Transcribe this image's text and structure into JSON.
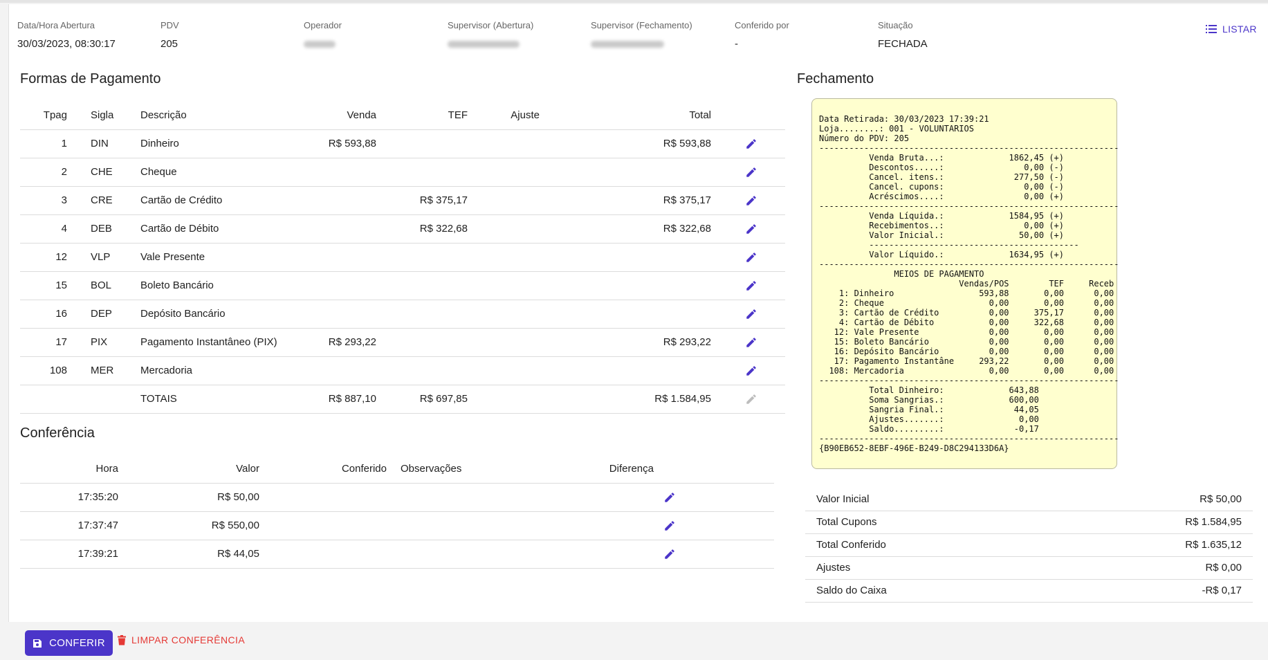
{
  "header": {
    "fields": [
      {
        "label": "Data/Hora Abertura",
        "value": "30/03/2023, 08:30:17"
      },
      {
        "label": "PDV",
        "value": "205"
      },
      {
        "label": "Operador",
        "value": ""
      },
      {
        "label": "Supervisor (Abertura)",
        "value": ""
      },
      {
        "label": "Supervisor (Fechamento)",
        "value": ""
      },
      {
        "label": "Conferido por",
        "value": "-"
      },
      {
        "label": "Situação",
        "value": "FECHADA"
      }
    ],
    "listar_label": "LISTAR"
  },
  "pagamento": {
    "title": "Formas de Pagamento",
    "columns": {
      "tpag": "Tpag",
      "sigla": "Sigla",
      "descricao": "Descrição",
      "venda": "Venda",
      "tef": "TEF",
      "ajuste": "Ajuste",
      "total": "Total"
    },
    "rows": [
      {
        "tpag": "1",
        "sigla": "DIN",
        "descricao": "Dinheiro",
        "venda": "R$ 593,88",
        "tef": "",
        "ajuste": "",
        "total": "R$ 593,88"
      },
      {
        "tpag": "2",
        "sigla": "CHE",
        "descricao": "Cheque",
        "venda": "",
        "tef": "",
        "ajuste": "",
        "total": ""
      },
      {
        "tpag": "3",
        "sigla": "CRE",
        "descricao": "Cartão de Crédito",
        "venda": "",
        "tef": "R$ 375,17",
        "ajuste": "",
        "total": "R$ 375,17"
      },
      {
        "tpag": "4",
        "sigla": "DEB",
        "descricao": "Cartão de Débito",
        "venda": "",
        "tef": "R$ 322,68",
        "ajuste": "",
        "total": "R$ 322,68"
      },
      {
        "tpag": "12",
        "sigla": "VLP",
        "descricao": "Vale Presente",
        "venda": "",
        "tef": "",
        "ajuste": "",
        "total": ""
      },
      {
        "tpag": "15",
        "sigla": "BOL",
        "descricao": "Boleto Bancário",
        "venda": "",
        "tef": "",
        "ajuste": "",
        "total": ""
      },
      {
        "tpag": "16",
        "sigla": "DEP",
        "descricao": "Depósito Bancário",
        "venda": "",
        "tef": "",
        "ajuste": "",
        "total": ""
      },
      {
        "tpag": "17",
        "sigla": "PIX",
        "descricao": "Pagamento Instantâneo (PIX)",
        "venda": "R$ 293,22",
        "tef": "",
        "ajuste": "",
        "total": "R$ 293,22"
      },
      {
        "tpag": "108",
        "sigla": "MER",
        "descricao": "Mercadoria",
        "venda": "",
        "tef": "",
        "ajuste": "",
        "total": ""
      }
    ],
    "totals": {
      "label": "TOTAIS",
      "venda": "R$ 887,10",
      "tef": "R$ 697,85",
      "ajuste": "",
      "total": "R$ 1.584,95"
    }
  },
  "conferencia": {
    "title": "Conferência",
    "columns": {
      "hora": "Hora",
      "valor": "Valor",
      "conferido": "Conferido",
      "observacoes": "Observações",
      "diferenca": "Diferença"
    },
    "rows": [
      {
        "hora": "17:35:20",
        "valor": "R$ 50,00",
        "conferido": "",
        "observacoes": "",
        "diferenca": ""
      },
      {
        "hora": "17:37:47",
        "valor": "R$ 550,00",
        "conferido": "",
        "observacoes": "",
        "diferenca": ""
      },
      {
        "hora": "17:39:21",
        "valor": "R$ 44,05",
        "conferido": "",
        "observacoes": "",
        "diferenca": ""
      }
    ]
  },
  "fechamento": {
    "title": "Fechamento",
    "receipt_text": "Data Retirada: 30/03/2023 17:39:21\nLoja........: 001 - VOLUNTARIOS\nNúmero do PDV: 205\n------------------------------------------------------------\n          Venda Bruta...:             1862,45 (+)\n          Descontos.....:                0,00 (-)\n          Cancel. itens.:              277,50 (-)\n          Cancel. cupons:                0,00 (-)\n          Acréscimos....:                0,00 (+)\n------------------------------------------------------------\n          Venda Líquida.:             1584,95 (+)\n          Recebimentos..:                0,00 (+)\n          Valor Inicial.:               50,00 (+)\n          ------------------------------------------\n          Valor Líquido.:             1634,95 (+)\n------------------------------------------------------------\n               MEIOS DE PAGAMENTO\n                            Vendas/POS        TEF     Receb\n    1: Dinheiro                 593,88       0,00      0,00\n    2: Cheque                     0,00       0,00      0,00\n    3: Cartão de Crédito          0,00     375,17      0,00\n    4: Cartão de Débito           0,00     322,68      0,00\n   12: Vale Presente              0,00       0,00      0,00\n   15: Boleto Bancário            0,00       0,00      0,00\n   16: Depósito Bancário          0,00       0,00      0,00\n   17: Pagamento Instantâne     293,22       0,00      0,00\n  108: Mercadoria                 0,00       0,00      0,00\n------------------------------------------------------------\n          Total Dinheiro:             643,88\n          Soma Sangrias.:             600,00\n          Sangria Final.:              44,05\n          Ajustes.......:               0,00\n          Saldo.........:              -0,17\n------------------------------------------------------------\n{B90EB652-8EBF-496E-B249-D8C294133D6A}"
  },
  "summary": [
    {
      "label": "Valor Inicial",
      "value": "R$ 50,00"
    },
    {
      "label": "Total Cupons",
      "value": "R$ 1.584,95"
    },
    {
      "label": "Total Conferido",
      "value": "R$ 1.635,12"
    },
    {
      "label": "Ajustes",
      "value": "R$ 0,00"
    },
    {
      "label": "Saldo do Caixa",
      "value": "-R$ 0,17"
    }
  ],
  "actions": {
    "conferir_label": "CONFERIR",
    "limpar_label": "LIMPAR CONFERÊNCIA"
  },
  "colors": {
    "accent": "#4b35c9",
    "danger": "#e53935",
    "receipt_bg": "#ffffcf",
    "disabled_icon": "#bdbdbd"
  },
  "icons": {
    "edit": "pencil-icon",
    "list": "list-icon",
    "save": "floppy-disk-icon",
    "delete": "trash-icon"
  }
}
